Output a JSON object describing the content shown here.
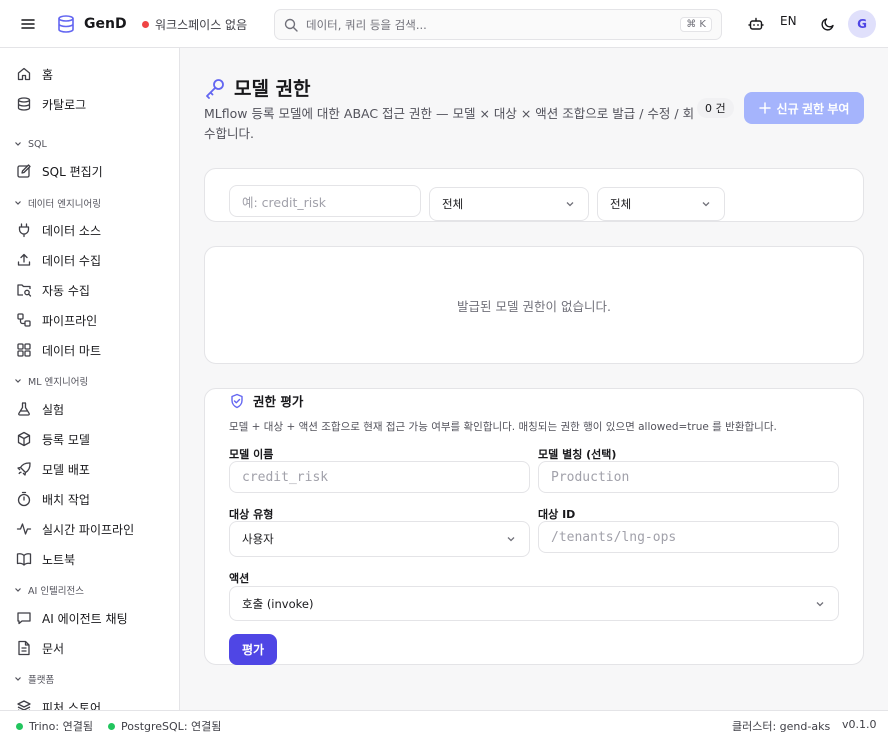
{
  "topbar": {
    "app_name": "GenD",
    "workspace": "워크스페이스 없음",
    "search_placeholder": "데이터, 쿼리 등을 검색...",
    "search_shortcut": "⌘ K",
    "language": "EN",
    "avatar_initial": "G"
  },
  "sidebar": {
    "home": "홈",
    "catalog": "카탈로그",
    "sections": {
      "sql": "SQL",
      "data_eng": "데이터 엔지니어링",
      "ml_eng": "ML 엔지니어링",
      "ai": "AI 인텔리전스",
      "platform": "플랫폼"
    },
    "items": {
      "sql_editor": "SQL 편집기",
      "data_source": "데이터 소스",
      "data_ingest": "데이터 수집",
      "auto_ingest": "자동 수집",
      "pipeline": "파이프라인",
      "data_mart": "데이터 마트",
      "experiment": "실험",
      "registered_model": "등록 모델",
      "model_deploy": "모델 배포",
      "batch_job": "배치 작업",
      "realtime_pipeline": "실시간 파이프라인",
      "notebook": "노트북",
      "ai_agent_chat": "AI 에이전트 채팅",
      "docs": "문서",
      "feature_store": "피처 스토어"
    }
  },
  "page": {
    "title": "모델 권한",
    "description": "MLflow 등록 모델에 대한 ABAC 접근 권한 — 모델 × 대상 × 액션 조합으로 발급 / 수정 / 회수합니다.",
    "count_badge": "0 건",
    "grant_button": "신규 권한 부여"
  },
  "filters": {
    "search_placeholder": "예: credit_risk",
    "select1_value": "전체",
    "select2_value": "전체"
  },
  "empty_state": "발급된 모델 권한이 없습니다.",
  "evaluation": {
    "title": "권한 평가",
    "description": "모델 + 대상 + 액션 조합으로 현재 접근 가능 여부를 확인합니다. 매칭되는 권한 행이 있으면 allowed=true 를 반환합니다.",
    "model_name_label": "모델 이름",
    "model_name_placeholder": "credit_risk",
    "model_alias_label": "모델 별칭 (선택)",
    "model_alias_placeholder": "Production",
    "target_type_label": "대상 유형",
    "target_type_value": "사용자",
    "target_id_label": "대상 ID",
    "target_id_placeholder": "/tenants/lng-ops",
    "action_label": "액션",
    "action_value": "호출 (invoke)",
    "evaluate_button": "평가"
  },
  "statusbar": {
    "trino": "Trino: 연결됨",
    "postgres": "PostgreSQL: 연결됨",
    "cluster": "클러스터: gend-aks",
    "version": "v0.1.0"
  },
  "colors": {
    "accent": "#4f46e5",
    "accent_light": "#a5b4fc",
    "status_ok": "#22c55e",
    "status_warn": "#ef4444"
  }
}
